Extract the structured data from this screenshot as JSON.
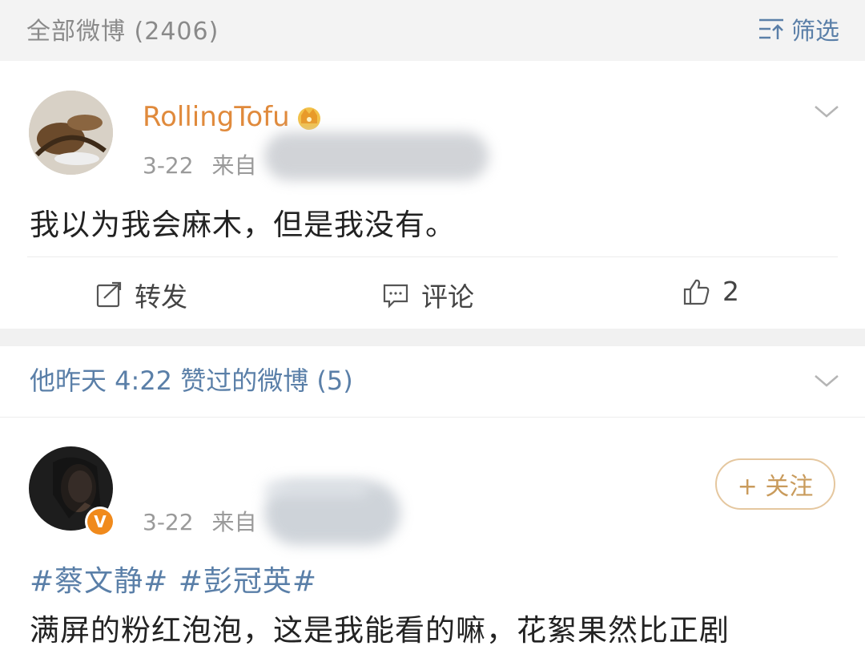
{
  "header": {
    "title": "全部微博 (2406)",
    "filter_label": "筛选",
    "filter_icon": "filter-icon"
  },
  "post1": {
    "username": "RollingTofu",
    "badge_icon": "crown-icon",
    "date": "3-22",
    "source_prefix": "来自",
    "text": "我以为我会麻木，但是我没有。",
    "actions": {
      "repost_label": "转发",
      "comment_label": "评论",
      "like_count": "2"
    }
  },
  "liked_section": {
    "title": "他昨天 4:22 赞过的微博 (5)"
  },
  "post2": {
    "date": "3-22",
    "source_prefix": "来自",
    "verified_badge": "V",
    "follow_label": "+ 关注",
    "hashtags": "#蔡文静# #彭冠英#",
    "text": "满屏的粉红泡泡，这是我能看的嘛，花絮果然比正剧"
  },
  "colors": {
    "accent_blue": "#5a7fa8",
    "username_orange": "#e08a3c",
    "follow_gold": "#c99b5c",
    "verified_orange": "#f08a1c"
  }
}
